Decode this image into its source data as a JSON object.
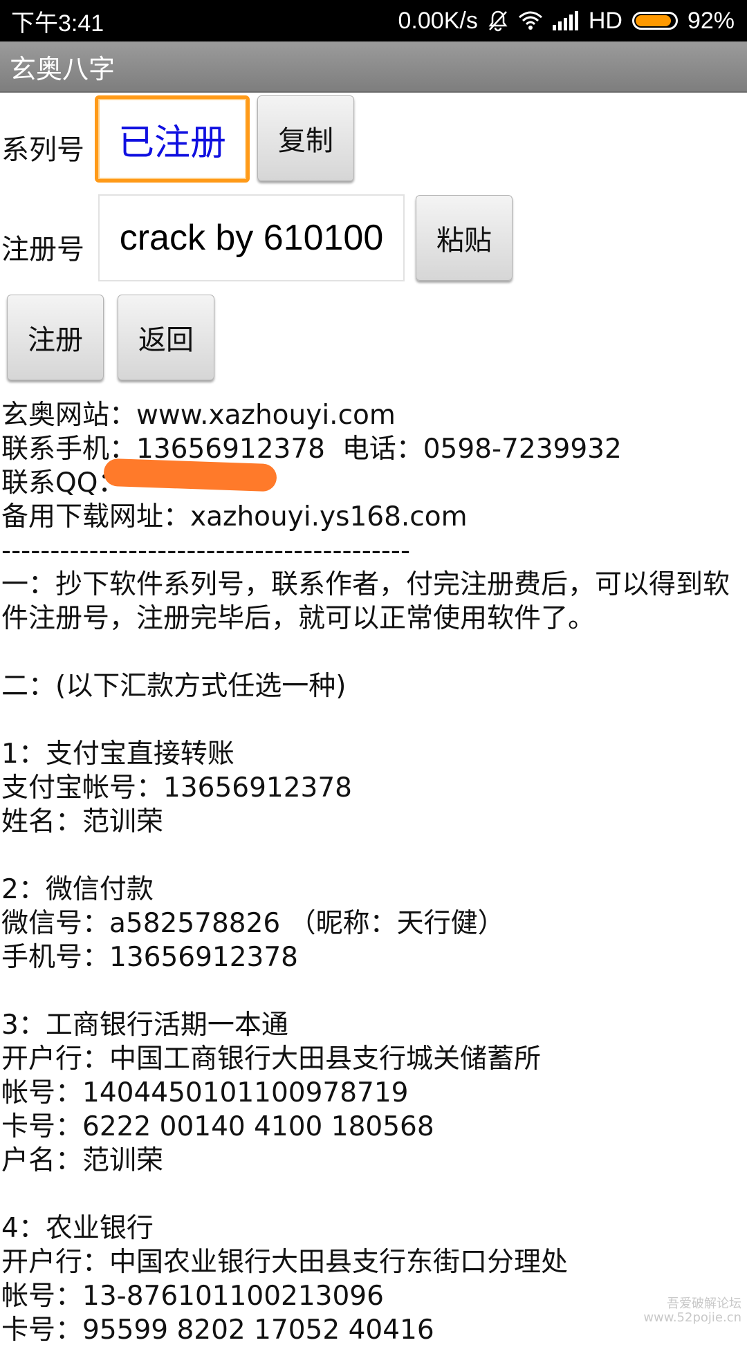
{
  "status_bar": {
    "time": "下午3:41",
    "net_speed": "0.00K/s",
    "network": "HD",
    "battery": "92%",
    "battery_level": 0.92,
    "icons": [
      "bell-off-icon",
      "wifi-icon",
      "signal-icon",
      "battery-icon"
    ]
  },
  "title": "玄奥八字",
  "form": {
    "serial_label": "系列号",
    "serial_value": "已注册",
    "copy_button": "复制",
    "reg_label": "注册号",
    "reg_value": "crack by 610100",
    "paste_button": "粘贴",
    "register_button": "注册",
    "back_button": "返回"
  },
  "info": {
    "website": "玄奥网站：www.xazhouyi.com",
    "contact": "联系手机：13656912378  电话：0598-7239932",
    "qq": "联系QQ：",
    "backup": "备用下载网址：xazhouyi.ys168.com",
    "divider": "------------------------------------------",
    "step1": "一：抄下软件系列号，联系作者，付完注册费后，可以得到软件注册号，注册完毕后，就可以正常使用软件了。",
    "step2": "二：(以下汇款方式任选一种)",
    "pay1_title": "1：支付宝直接转账",
    "pay1_account": "支付宝帐号：13656912378",
    "pay1_name": "姓名：范训荣",
    "pay2_title": "2：微信付款",
    "pay2_wechat": "微信号：a582578826 （昵称：天行健）",
    "pay2_phone": "手机号：13656912378",
    "pay3_title": "3：工商银行活期一本通",
    "pay3_bank": "开户行：中国工商银行大田县支行城关储蓄所",
    "pay3_account": "帐号：1404450101100978719",
    "pay3_card": "卡号：6222 00140 4100 180568",
    "pay3_name": "户名：范训荣",
    "pay4_title": "4：农业银行",
    "pay4_bank": "开户行：中国农业银行大田县支行东街口分理处",
    "pay4_account": "帐号：13-876101100213096",
    "pay4_card": "卡号：95599 8202 17052 40416"
  },
  "watermark": [
    "吾爱破解论坛",
    "www.52pojie.cn"
  ],
  "colors": {
    "focus_border": "#ff9a18",
    "serial_text": "#1010e0",
    "redaction": "#ff7a2a"
  }
}
